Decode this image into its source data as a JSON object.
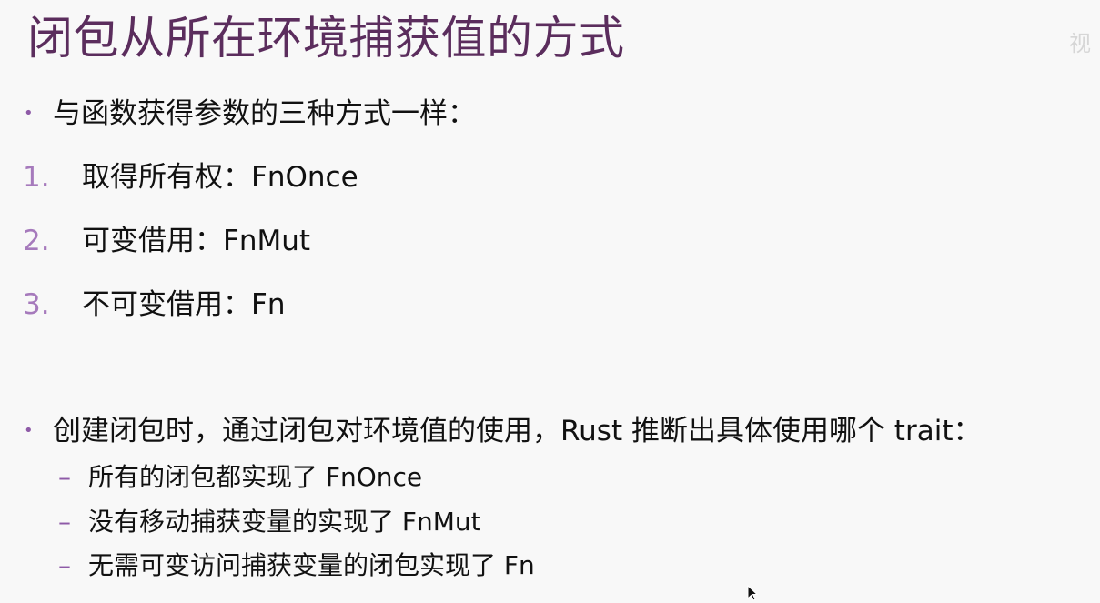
{
  "slide": {
    "title": "闭包从所在环境捕获值的方式",
    "watermark": "视",
    "bullets": {
      "intro": "与函数获得参数的三种方式一样：",
      "inference": "创建闭包时，通过闭包对环境值的使用，Rust 推断出具体使用哪个 trait："
    },
    "numbered": [
      {
        "marker": "1.",
        "text": "取得所有权：FnOnce"
      },
      {
        "marker": "2.",
        "text": "可变借用：FnMut"
      },
      {
        "marker": "3.",
        "text": "不可变借用：Fn"
      }
    ],
    "sub_items": [
      {
        "dash": "–",
        "text": "所有的闭包都实现了 FnOnce"
      },
      {
        "dash": "–",
        "text": "没有移动捕获变量的实现了 FnMut"
      },
      {
        "dash": "–",
        "text": "无需可变访问捕获变量的闭包实现了 Fn"
      }
    ]
  },
  "colors": {
    "background": "#f8f8f8",
    "title": "#5b2d5d",
    "body_text": "#111111",
    "bullet_accent": "#8e5aa7",
    "number_accent": "#a67abc"
  },
  "icons": {
    "cursor": "mouse-pointer-icon",
    "watermark": "watermark-icon"
  }
}
